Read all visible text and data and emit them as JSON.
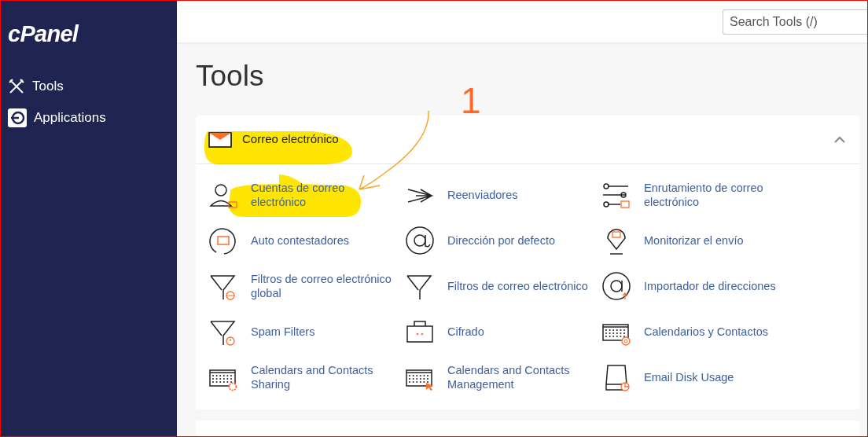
{
  "sidebar": {
    "logo": "cPanel",
    "items": [
      {
        "label": "Tools"
      },
      {
        "label": "Applications"
      }
    ]
  },
  "search": {
    "placeholder": "Search Tools (/)"
  },
  "page_title": "Tools",
  "section": {
    "title": "Correo electrónico",
    "expanded": true,
    "items": [
      {
        "label": "Cuentas de correo electrónico"
      },
      {
        "label": "Reenviadores"
      },
      {
        "label": "Enrutamiento de correo electrónico"
      },
      {
        "label": "Auto contestadores"
      },
      {
        "label": "Dirección por defecto"
      },
      {
        "label": "Monitorizar el envío"
      },
      {
        "label": "Filtros de correo electrónico global"
      },
      {
        "label": "Filtros de correo electrónico"
      },
      {
        "label": "Importador de direcciones"
      },
      {
        "label": "Spam Filters"
      },
      {
        "label": "Cifrado"
      },
      {
        "label": "Calendarios y Contactos"
      },
      {
        "label": "Calendars and Contacts Sharing"
      },
      {
        "label": "Calendars and Contacts Management"
      },
      {
        "label": "Email Disk Usage"
      }
    ]
  },
  "annotation": {
    "label": "1"
  }
}
